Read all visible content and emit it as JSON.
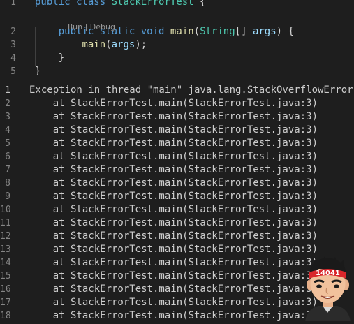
{
  "editor": {
    "codelens": {
      "run": "Run",
      "separator": " | ",
      "debug": "Debug"
    },
    "lines": [
      {
        "num": "1",
        "tokens": [
          {
            "t": "public",
            "c": "kw"
          },
          {
            "t": " ",
            "c": "pn"
          },
          {
            "t": "class",
            "c": "kw"
          },
          {
            "t": " ",
            "c": "pn"
          },
          {
            "t": "StackErrorTest",
            "c": "ty"
          },
          {
            "t": " {",
            "c": "pn"
          }
        ]
      },
      {
        "num": "2",
        "tokens": [
          {
            "t": "    ",
            "c": "pn"
          },
          {
            "t": "public",
            "c": "kw"
          },
          {
            "t": " ",
            "c": "pn"
          },
          {
            "t": "static",
            "c": "kw"
          },
          {
            "t": " ",
            "c": "pn"
          },
          {
            "t": "void",
            "c": "kw"
          },
          {
            "t": " ",
            "c": "pn"
          },
          {
            "t": "main",
            "c": "fn"
          },
          {
            "t": "(",
            "c": "pn"
          },
          {
            "t": "String",
            "c": "ty"
          },
          {
            "t": "[] ",
            "c": "pn"
          },
          {
            "t": "args",
            "c": "vr"
          },
          {
            "t": ") {",
            "c": "pn"
          }
        ]
      },
      {
        "num": "3",
        "tokens": [
          {
            "t": "        ",
            "c": "pn"
          },
          {
            "t": "main",
            "c": "fn"
          },
          {
            "t": "(",
            "c": "pn"
          },
          {
            "t": "args",
            "c": "vr"
          },
          {
            "t": ");",
            "c": "pn"
          }
        ]
      },
      {
        "num": "4",
        "tokens": [
          {
            "t": "    }",
            "c": "pn"
          }
        ]
      },
      {
        "num": "5",
        "tokens": [
          {
            "t": "}",
            "c": "pn"
          }
        ]
      }
    ]
  },
  "terminal": {
    "lines": [
      {
        "num": "1",
        "text": "Exception in thread \"main\" java.lang.StackOverflowError"
      },
      {
        "num": "2",
        "text": "    at StackErrorTest.main(StackErrorTest.java:3)"
      },
      {
        "num": "3",
        "text": "    at StackErrorTest.main(StackErrorTest.java:3)"
      },
      {
        "num": "4",
        "text": "    at StackErrorTest.main(StackErrorTest.java:3)"
      },
      {
        "num": "5",
        "text": "    at StackErrorTest.main(StackErrorTest.java:3)"
      },
      {
        "num": "6",
        "text": "    at StackErrorTest.main(StackErrorTest.java:3)"
      },
      {
        "num": "7",
        "text": "    at StackErrorTest.main(StackErrorTest.java:3)"
      },
      {
        "num": "8",
        "text": "    at StackErrorTest.main(StackErrorTest.java:3)"
      },
      {
        "num": "9",
        "text": "    at StackErrorTest.main(StackErrorTest.java:3)"
      },
      {
        "num": "10",
        "text": "    at StackErrorTest.main(StackErrorTest.java:3)"
      },
      {
        "num": "11",
        "text": "    at StackErrorTest.main(StackErrorTest.java:3)"
      },
      {
        "num": "12",
        "text": "    at StackErrorTest.main(StackErrorTest.java:3)"
      },
      {
        "num": "13",
        "text": "    at StackErrorTest.main(StackErrorTest.java:3)"
      },
      {
        "num": "14",
        "text": "    at StackErrorTest.main(StackErrorTest.java:3)"
      },
      {
        "num": "15",
        "text": "    at StackErrorTest.main(StackErrorTest.java:3)"
      },
      {
        "num": "16",
        "text": "    at StackErrorTest.main(StackErrorTest.java:3)"
      },
      {
        "num": "17",
        "text": "    at StackErrorTest.main(StackErrorTest.java:3)"
      },
      {
        "num": "18",
        "text": "    at StackErrorTest.main(StackErrorTest.java:3)"
      }
    ]
  },
  "avatar": {
    "badge_text": "14041",
    "icon": "cartoon-avatar-icon"
  },
  "colors": {
    "background": "#1e1e1e",
    "keyword": "#569cd6",
    "type": "#4ec9b0",
    "function": "#dcdcaa",
    "variable": "#9cdcfe",
    "text": "#cccccc",
    "line_number": "#858585"
  }
}
